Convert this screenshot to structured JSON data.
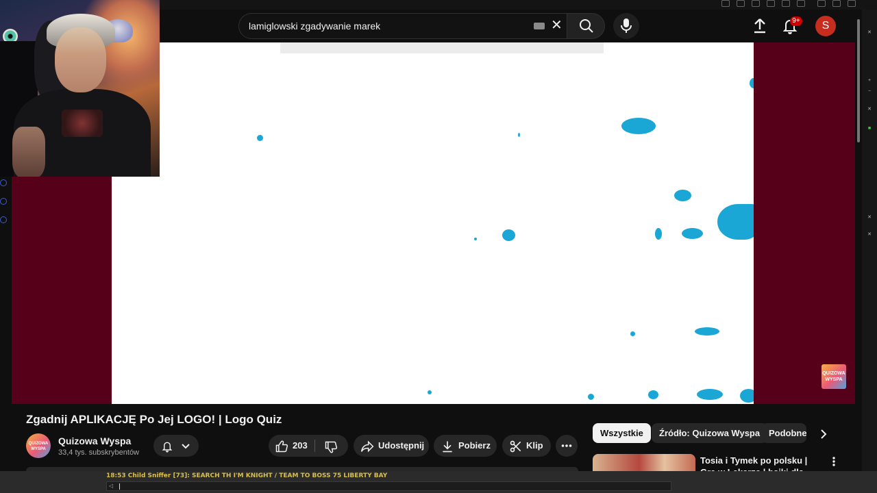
{
  "header": {
    "search_value": "lamiglowski zgadywanie marek",
    "notifications_badge": "9+",
    "avatar_letter": "S"
  },
  "player": {
    "corner_logo_text": "QUIZOWA WYSPA"
  },
  "video": {
    "title": "Zgadnij APLIKACJĘ Po Jej LOGO! | Logo Quiz",
    "channel_name": "Quizowa Wyspa",
    "channel_avatar_text": "QUIZOWA WYSPA",
    "subscribers": "33,4 tys. subskrybentów",
    "like_count": "203",
    "share_label": "Udostępnij",
    "download_label": "Pobierz",
    "clip_label": "Klip"
  },
  "chips": [
    {
      "label": "Wszystkie"
    },
    {
      "label": "Źródło: Quizowa Wyspa"
    },
    {
      "label": "Podobne"
    }
  ],
  "recommendation": {
    "title": "Tosia i Tymek po polsku | Gra w Lekarza | bajki dla dzieci po"
  },
  "console": {
    "log_line": "18:53 Child Sniffer [73]: SEARCH TH I'M KNIGHT / TEAM TO BOSS 75 LIBERTY BAY",
    "mark": "◁"
  },
  "colors": {
    "player_background": "#57001a",
    "paint_blob": "#1aa7d6",
    "accent_red": "#cc0000"
  }
}
